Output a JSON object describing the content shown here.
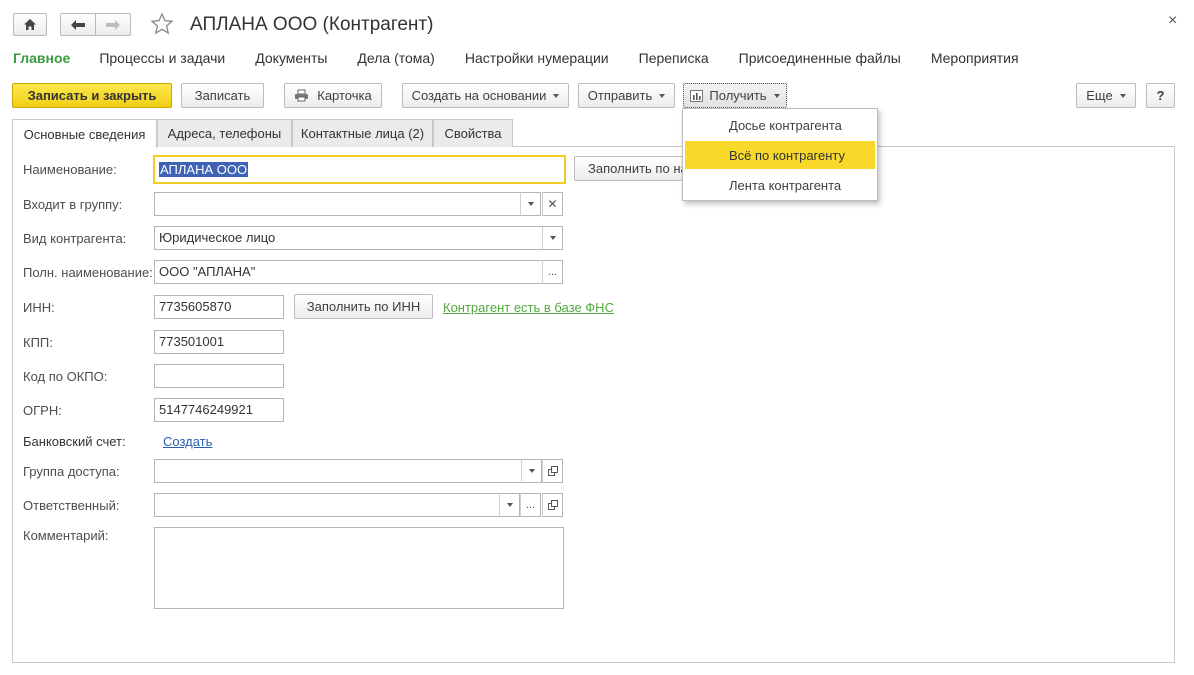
{
  "window": {
    "title": "АПЛАНА ООО (Контрагент)",
    "home_icon": "home-icon",
    "back_icon": "arrow-left-icon",
    "forward_icon": "arrow-right-icon",
    "favorite_icon": "star-icon",
    "close_label": "×"
  },
  "sections": [
    {
      "label": "Главное",
      "active": true
    },
    {
      "label": "Процессы и задачи"
    },
    {
      "label": "Документы"
    },
    {
      "label": "Дела (тома)"
    },
    {
      "label": "Настройки нумерации"
    },
    {
      "label": "Переписка"
    },
    {
      "label": "Присоединенные файлы"
    },
    {
      "label": "Мероприятия"
    }
  ],
  "toolbar": {
    "save_close": "Записать и закрыть",
    "save": "Записать",
    "card": "Карточка",
    "create_based": "Создать на основании",
    "send": "Отправить",
    "get": "Получить",
    "more": "Еще",
    "help": "?"
  },
  "get_menu": {
    "items": [
      {
        "label": "Досье контрагента"
      },
      {
        "label": "Всё по контрагенту",
        "highlighted": true
      },
      {
        "label": "Лента контрагента"
      }
    ]
  },
  "tabs": [
    {
      "label": "Основные сведения",
      "active": true
    },
    {
      "label": "Адреса, телефоны"
    },
    {
      "label": "Контактные лица (2)"
    },
    {
      "label": "Свойства"
    }
  ],
  "form": {
    "name_label": "Наименование:",
    "name_value": "АПЛАНА ООО",
    "fill_by_name": "Заполнить по на",
    "group_label": "Входит в группу:",
    "group_value": "",
    "kind_label": "Вид контрагента:",
    "kind_value": "Юридическое лицо",
    "full_name_label": "Полн. наименование:",
    "full_name_value": "ООО \"АПЛАНА\"",
    "inn_label": "ИНН:",
    "inn_value": "7735605870",
    "fill_by_inn": "Заполнить по ИНН",
    "fns_status": "Контрагент есть в базе ФНС",
    "kpp_label": "КПП:",
    "kpp_value": "773501001",
    "okpo_label": "Код по ОКПО:",
    "okpo_value": "",
    "ogrn_label": "ОГРН:",
    "ogrn_value": "5147746249921",
    "bank_label": "Банковский счет:",
    "bank_create": "Создать",
    "access_label": "Группа доступа:",
    "access_value": "",
    "responsible_label": "Ответственный:",
    "responsible_value": "",
    "comment_label": "Комментарий:",
    "comment_value": ""
  },
  "colors": {
    "accent_green": "#3c9a42",
    "primary_yellow": "#f8d829",
    "link_blue": "#2a5db0",
    "status_green": "#54a83f"
  }
}
